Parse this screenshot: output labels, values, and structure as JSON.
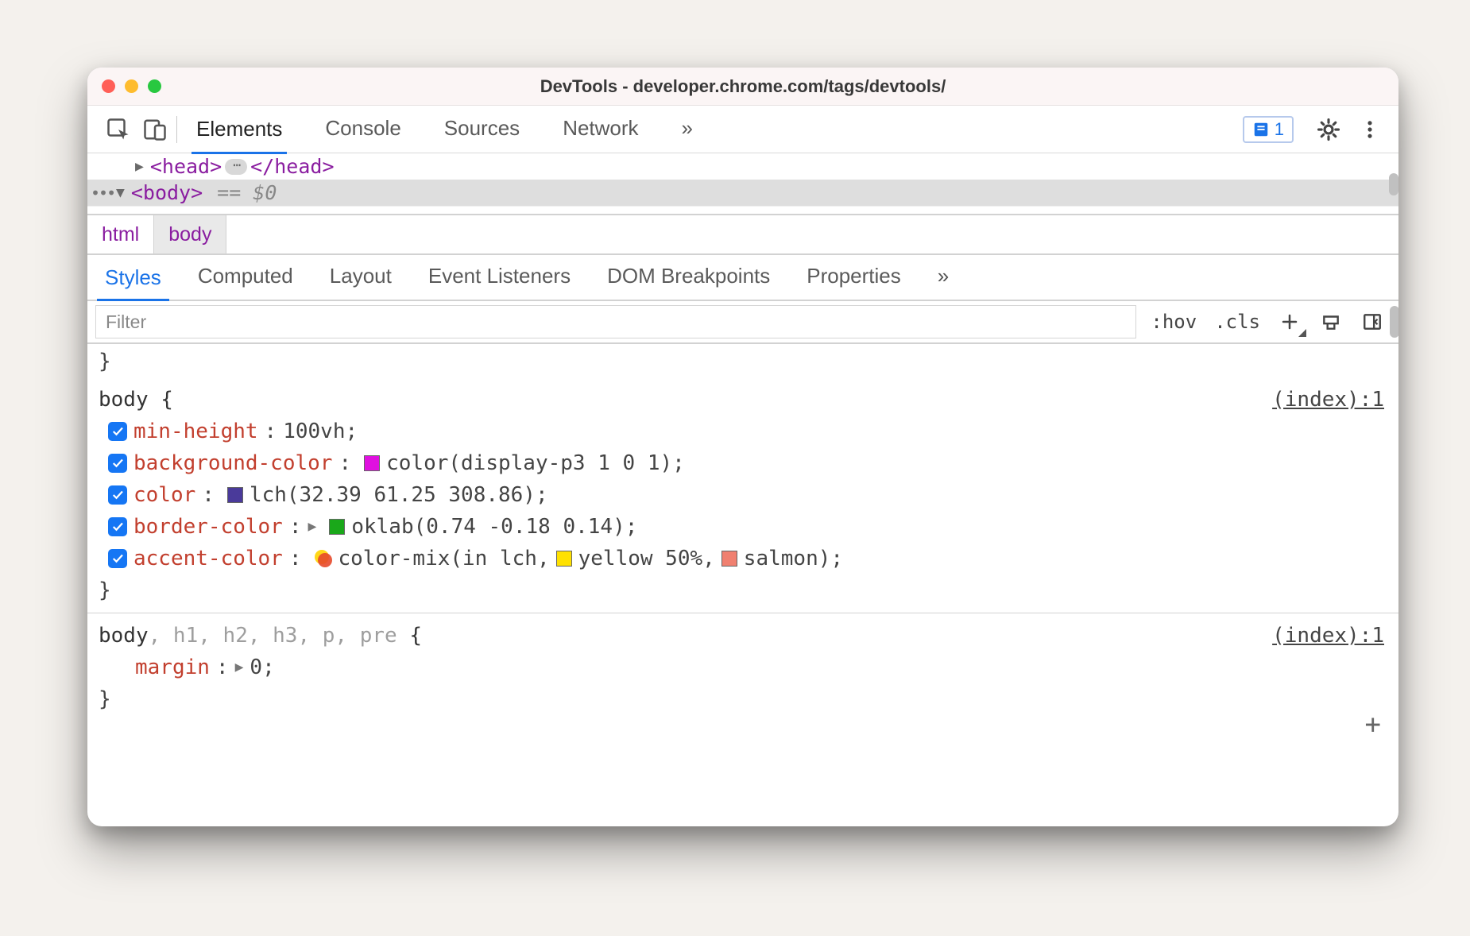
{
  "window": {
    "title": "DevTools - developer.chrome.com/tags/devtools/"
  },
  "main_tabs": {
    "items": [
      "Elements",
      "Console",
      "Sources",
      "Network"
    ],
    "active_index": 0,
    "overflow_glyph": "»",
    "issues_count": "1"
  },
  "dom_tree": {
    "head_open": "<head>",
    "head_close": "</head>",
    "body_open": "<body>",
    "selected_marker": "== $0",
    "ellipsis_glyph": "⋯"
  },
  "breadcrumbs": {
    "items": [
      "html",
      "body"
    ],
    "active_index": 1
  },
  "sub_tabs": {
    "items": [
      "Styles",
      "Computed",
      "Layout",
      "Event Listeners",
      "DOM Breakpoints",
      "Properties"
    ],
    "active_index": 0,
    "overflow_glyph": "»"
  },
  "filter_bar": {
    "placeholder": "Filter",
    "hov_label": ":hov",
    "cls_label": ".cls"
  },
  "styles": {
    "stray_close": "}",
    "rule1": {
      "selector": "body {",
      "source": "(index):1",
      "declarations": [
        {
          "prop": "min-height",
          "colon": ":",
          "value_parts": [
            {
              "t": "text",
              "v": " 100vh;"
            }
          ]
        },
        {
          "prop": "background-color",
          "colon": ":",
          "value_parts": [
            {
              "t": "pad",
              "v": " "
            },
            {
              "t": "swatch",
              "color": "#e010e0"
            },
            {
              "t": "text",
              "v": "color(display-p3 1 0 1);"
            }
          ]
        },
        {
          "prop": "color",
          "colon": ":",
          "value_parts": [
            {
              "t": "pad",
              "v": " "
            },
            {
              "t": "swatch",
              "color": "#4a3a9a"
            },
            {
              "t": "text",
              "v": "lch(32.39 61.25 308.86);"
            }
          ]
        },
        {
          "prop": "border-color",
          "colon": ":",
          "value_parts": [
            {
              "t": "tri"
            },
            {
              "t": "pad",
              "v": " "
            },
            {
              "t": "swatch",
              "color": "#1aa81a"
            },
            {
              "t": "text",
              "v": "oklab(0.74 -0.18 0.14);"
            }
          ]
        },
        {
          "prop": "accent-color",
          "colon": ":",
          "value_parts": [
            {
              "t": "pad",
              "v": " "
            },
            {
              "t": "mixswatch"
            },
            {
              "t": "text",
              "v": "color-mix(in lch, "
            },
            {
              "t": "swatch",
              "color": "#ffe100"
            },
            {
              "t": "text",
              "v": "yellow 50%, "
            },
            {
              "t": "swatch",
              "color": "#f08070"
            },
            {
              "t": "text",
              "v": "salmon);"
            }
          ]
        }
      ],
      "close": "}"
    },
    "rule2": {
      "selector_main": "body",
      "selector_dim": ", h1, h2, h3, p, pre",
      "selector_end": " {",
      "source": "(index):1",
      "declarations": [
        {
          "prop": "margin",
          "colon": ":",
          "value_parts": [
            {
              "t": "tri"
            },
            {
              "t": "text",
              "v": " 0;"
            }
          ]
        }
      ],
      "close": "}"
    },
    "add_glyph": "+"
  }
}
